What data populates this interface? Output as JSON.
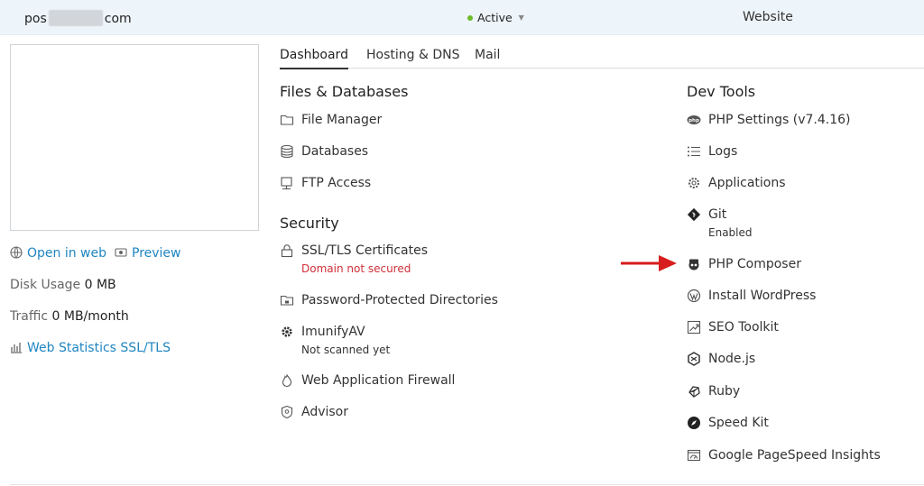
{
  "header": {
    "domain_prefix": "pos",
    "domain_suffix": "com",
    "status": "Active",
    "website_label": "Website"
  },
  "left": {
    "open_in_web": "Open in web",
    "preview": "Preview",
    "disk_usage_label": "Disk Usage",
    "disk_usage_value": "0 MB",
    "traffic_label": "Traffic",
    "traffic_value": "0 MB/month",
    "web_stats": "Web Statistics SSL/TLS"
  },
  "tabs": [
    {
      "label": "Dashboard",
      "active": true
    },
    {
      "label": "Hosting & DNS",
      "active": false
    },
    {
      "label": "Mail",
      "active": false
    }
  ],
  "files_databases": {
    "title": "Files & Databases",
    "items": [
      {
        "label": "File Manager",
        "icon": "folder-icon"
      },
      {
        "label": "Databases",
        "icon": "database-icon"
      },
      {
        "label": "FTP Access",
        "icon": "ftp-icon"
      }
    ]
  },
  "security": {
    "title": "Security",
    "items": [
      {
        "label": "SSL/TLS Certificates",
        "icon": "lock-icon",
        "sub": "Domain not secured"
      },
      {
        "label": "Password-Protected Directories",
        "icon": "lock-folder-icon"
      },
      {
        "label": "ImunifyAV",
        "icon": "gear-icon",
        "sub": "Not scanned yet"
      },
      {
        "label": "Web Application Firewall",
        "icon": "fire-icon"
      },
      {
        "label": "Advisor",
        "icon": "advisor-icon"
      }
    ]
  },
  "dev_tools": {
    "title": "Dev Tools",
    "items": [
      {
        "label": "PHP Settings (v7.4.16)",
        "icon": "php-icon"
      },
      {
        "label": "Logs",
        "icon": "list-icon"
      },
      {
        "label": "Applications",
        "icon": "cog-icon"
      },
      {
        "label": "Git",
        "icon": "git-icon",
        "sub": "Enabled"
      },
      {
        "label": "PHP Composer",
        "icon": "composer-icon"
      },
      {
        "label": "Install WordPress",
        "icon": "wordpress-icon"
      },
      {
        "label": "SEO Toolkit",
        "icon": "seo-icon"
      },
      {
        "label": "Node.js",
        "icon": "nodejs-icon"
      },
      {
        "label": "Ruby",
        "icon": "ruby-icon"
      },
      {
        "label": "Speed Kit",
        "icon": "speedkit-icon"
      },
      {
        "label": "Google PageSpeed Insights",
        "icon": "pagespeed-icon"
      }
    ]
  },
  "colors": {
    "link": "#1f85c1",
    "status_dot": "#6dbb29",
    "warning": "#d02f36",
    "arrow": "#d71d1d",
    "header_bg": "#edf4fa"
  }
}
